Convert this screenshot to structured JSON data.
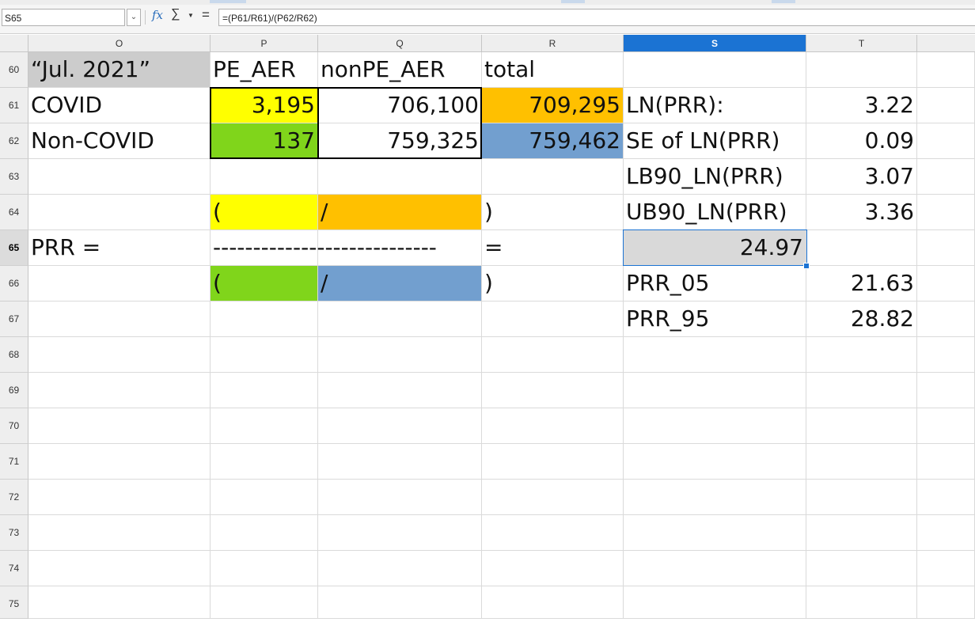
{
  "formula_bar": {
    "name_box": "S65",
    "formula": "=(P61/R61)/(P62/R62)",
    "fx_icon": "function-wizard-icon",
    "sum_icon": "sum-icon",
    "eq_icon": "formula-icon"
  },
  "columns": [
    "O",
    "P",
    "Q",
    "R",
    "S",
    "T"
  ],
  "active_column": "S",
  "rows": [
    "60",
    "61",
    "62",
    "63",
    "64",
    "65",
    "66",
    "67",
    "68",
    "69",
    "70",
    "71",
    "72",
    "73",
    "74",
    "75"
  ],
  "active_row": "65",
  "cells": {
    "O60": "“Jul. 2021”",
    "P60": "PE_AER",
    "Q60": "nonPE_AER",
    "R60": "total",
    "O61": "COVID",
    "P61": "3,195",
    "Q61": "706,100",
    "R61": "709,295",
    "S61": "LN(PRR):",
    "T61": "3.22",
    "O62": "Non-COVID",
    "P62": "137",
    "Q62": "759,325",
    "R62": "759,462",
    "S62": "SE of LN(PRR)",
    "T62": "0.09",
    "S63": "LB90_LN(PRR)",
    "T63": "3.07",
    "P64": "(",
    "Q64": "/",
    "R64": ")",
    "S64": "UB90_LN(PRR)",
    "T64": "3.36",
    "O65": "PRR =",
    "P65": "----------------------------",
    "R65": "=",
    "S65": "24.97",
    "P66": "(",
    "Q66": "/",
    "R66": ")",
    "S66": "PRR_05",
    "T66": "21.63",
    "S67": "PRR_95",
    "T67": "28.82"
  },
  "colors": {
    "yellow": "#ffff00",
    "orange": "#ffc000",
    "green": "#80d51b",
    "blue": "#729fcf",
    "header_grey": "#cccccc",
    "selection": "#1b73d3"
  }
}
